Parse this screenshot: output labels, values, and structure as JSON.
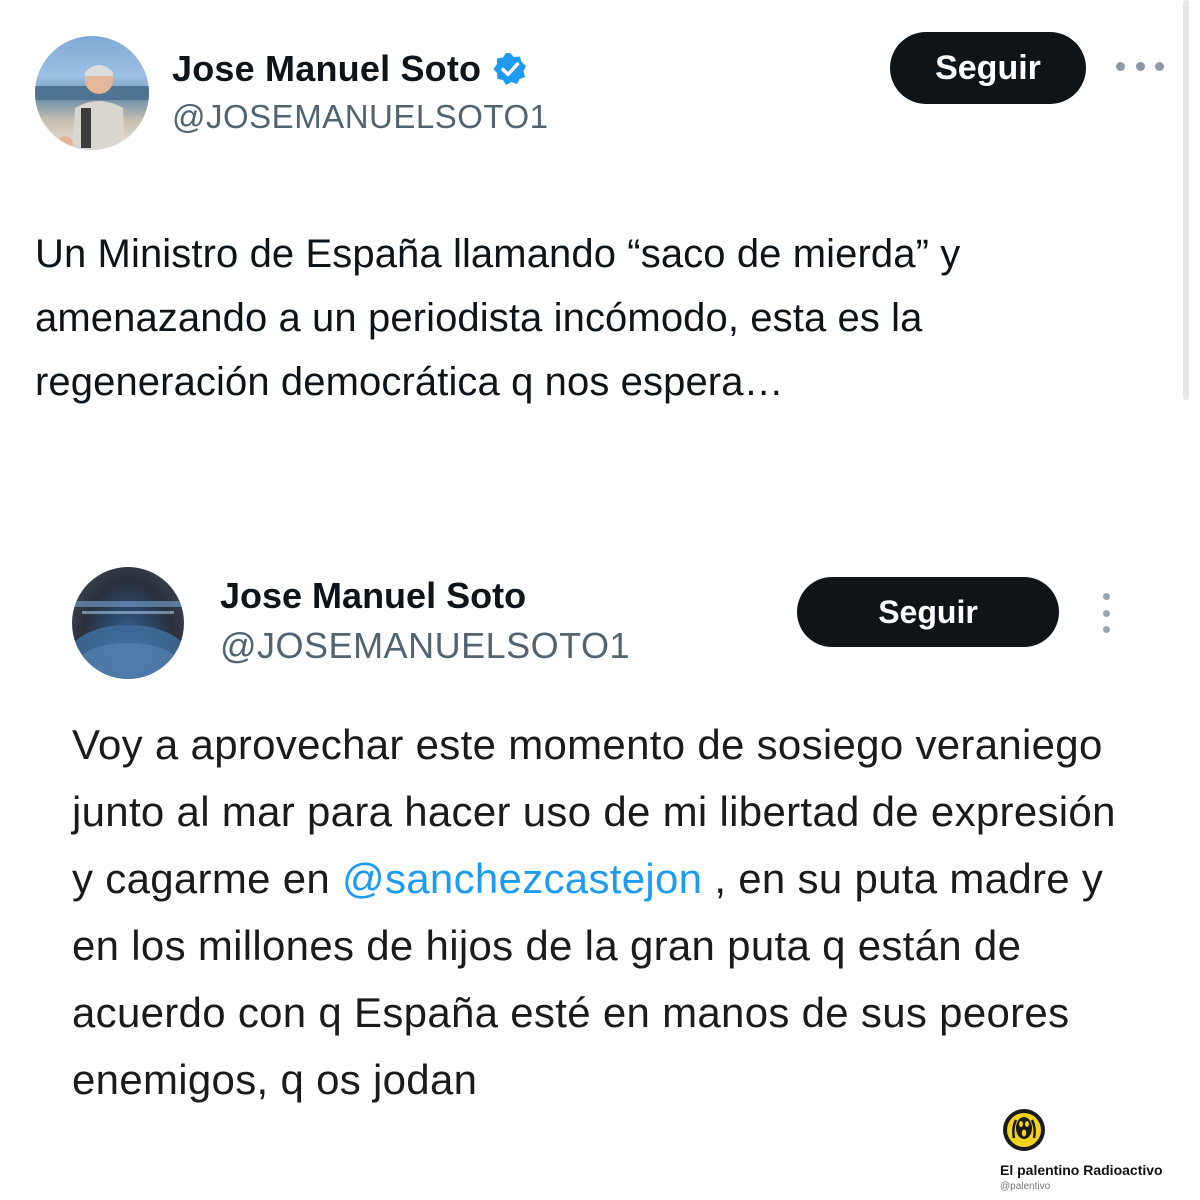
{
  "tweet": {
    "display_name": "Jose Manuel Soto",
    "handle": "@JOSEMANUELSOTO1",
    "follow_label": "Seguir",
    "text": "Un Ministro de España llamando “saco de mierda” y amenazando a un periodista incómodo, esta es la regeneración democrática q nos espera…",
    "icons": {
      "verified": "verified-badge-icon",
      "more": "more-horizontal-icon"
    },
    "colors": {
      "verified": "#1d9bf0",
      "button_bg": "#0f1419",
      "handle": "#536471"
    }
  },
  "embedded_tweet": {
    "display_name": "Jose Manuel Soto",
    "handle": "@JOSEMANUELSOTO1",
    "follow_label": "Seguir",
    "text_before": "Voy a aprovechar este momento de sosiego veraniego junto al mar para hacer uso de mi libertad de expresión y cagarme en ",
    "mention": "@sanchezcastejon",
    "text_after": " , en su puta madre y en los millones de hijos de la gran puta q están de acuerdo con q España esté en manos de sus peores enemigos, q os jodan",
    "icons": {
      "more": "more-vertical-icon"
    },
    "colors": {
      "mention": "#1d9bf0"
    }
  },
  "watermark": {
    "name": "El palentino Radioactivo",
    "handle": "@palentivo",
    "icon": "radioactive-scream-icon"
  }
}
